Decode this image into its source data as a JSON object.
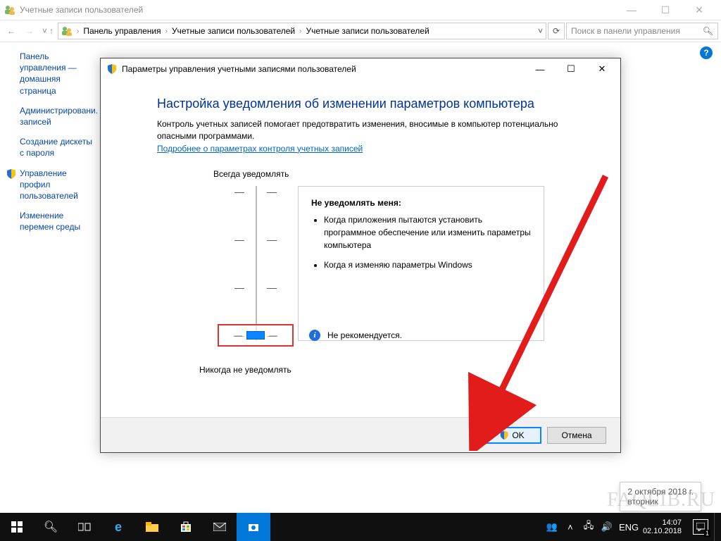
{
  "outer": {
    "title": "Учетные записи пользователей",
    "breadcrumb": [
      "Панель управления",
      "Учетные записи пользователей",
      "Учетные записи пользователей"
    ],
    "search_placeholder": "Поиск в панели управления"
  },
  "sidebar": {
    "items": [
      "Панель управления — домашняя страница",
      "Администрировани. записей",
      "Создание дискеты с пароля",
      "Управление профил пользователей",
      "Изменение перемен среды"
    ]
  },
  "uac": {
    "title": "Параметры управления учетными записями пользователей",
    "heading": "Настройка уведомления об изменении параметров компьютера",
    "desc": "Контроль учетных записей помогает предотвратить изменения, вносимые в компьютер потенциально опасными программами.",
    "link": "Подробнее о параметрах контроля учетных записей",
    "slider_top": "Всегда уведомлять",
    "slider_bottom": "Никогда не уведомлять",
    "panel_title": "Не уведомлять меня:",
    "bullets": [
      "Когда приложения пытаются установить программное обеспечение или изменить параметры компьютера",
      "Когда я изменяю параметры Windows"
    ],
    "note": "Не рекомендуется.",
    "ok": "OK",
    "cancel": "Отмена"
  },
  "tooltip": {
    "line1": "2 октября 2018 г.",
    "line2": "вторник"
  },
  "watermark": "FAQLIB.RU",
  "taskbar": {
    "lang": "ENG",
    "time": "14:07",
    "date": "02.10.2018"
  }
}
